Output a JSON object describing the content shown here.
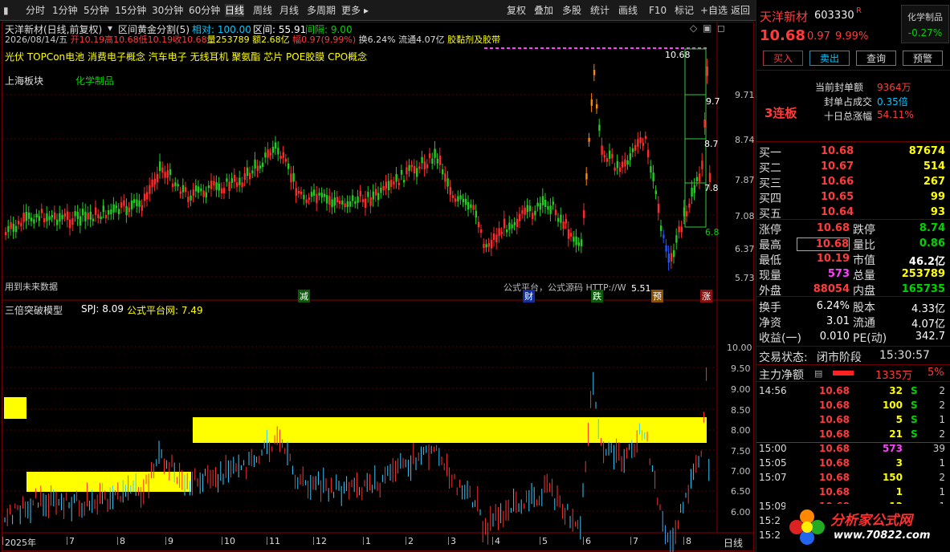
{
  "toolbar": {
    "items": [
      "分时",
      "1分钟",
      "5分钟",
      "15分钟",
      "30分钟",
      "60分钟",
      "日线",
      "周线",
      "月线",
      "多周期",
      "更多"
    ],
    "right": [
      "复权",
      "叠加",
      "多股",
      "统计",
      "画线",
      "F10",
      "标记",
      "+自选",
      "返回"
    ]
  },
  "chart_header": {
    "title": "天洋新材(日线,前复权)",
    "indicator": "区间黄金分割(5)",
    "relative": "相对: 100.00",
    "interval": "区间: 55.91",
    "gap": "间隔: 9.00"
  },
  "ohlc": {
    "date": "2026/08/14/五",
    "open": "开10.19",
    "high": "高10.68",
    "low": "低10.19",
    "close": "收10.68",
    "volume": "量253789",
    "amount": "额2.68亿",
    "change": "幅0.97(9.99%)",
    "turnover": "换6.24%",
    "float": "流通4.07亿",
    "concept": "胶黏剂及胶带"
  },
  "concepts": "光伏 TOPCon电池 消费电子概念 汽车电子 无线耳机 聚氨酯 芯片 POE胶膜 CPO概念",
  "sector": {
    "board": "上海板块",
    "industry": "化学制品"
  },
  "future_note": "用到未来数据",
  "watermark_note": "公式平台，公式源码 HTTP://W",
  "price_axis": [
    "9.71",
    "8.74",
    "7.87",
    "7.08",
    "6.37",
    "5.73"
  ],
  "price_top": "10.68",
  "fib_labels": [
    "9.7",
    "8.7",
    "7.8",
    "6.8"
  ],
  "low_marker": "5.51",
  "events": [
    "减",
    "财",
    "跌",
    "预",
    "涨"
  ],
  "sub_header": {
    "name": "三倍突破模型",
    "spj": "SPJ: 8.09",
    "gsp": "公式平台网: 7.49"
  },
  "sub_axis": [
    "10.00",
    "9.50",
    "9.00",
    "8.50",
    "8.00",
    "7.50",
    "7.00",
    "6.50",
    "6.00"
  ],
  "months": [
    "2025年",
    "7",
    "8",
    "9",
    "10",
    "11",
    "12",
    "1",
    "2",
    "3",
    "4",
    "5",
    "6",
    "7",
    "8"
  ],
  "period_label": "日线",
  "stock": {
    "name": "天洋新材",
    "code": "603330",
    "r": "R",
    "industry": "化学制品",
    "ind_change": "-0.27%",
    "price": "10.68",
    "change": "0.97",
    "pct": "9.99%"
  },
  "trade_buttons": [
    "买入",
    "卖出",
    "查询",
    "预警"
  ],
  "limit_info": {
    "rows": [
      {
        "k": "当前封单额",
        "v": "9364万"
      },
      {
        "k": "封单占成交",
        "v": "0.35倍"
      },
      {
        "k": "十日总涨幅",
        "v": "54.11%"
      }
    ],
    "streak": "3连板"
  },
  "bids": [
    {
      "k": "买一",
      "p": "10.68",
      "v": "87674"
    },
    {
      "k": "买二",
      "p": "10.67",
      "v": "514"
    },
    {
      "k": "买三",
      "p": "10.66",
      "v": "267"
    },
    {
      "k": "买四",
      "p": "10.65",
      "v": "99"
    },
    {
      "k": "买五",
      "p": "10.64",
      "v": "93"
    }
  ],
  "stats": [
    {
      "k1": "涨停",
      "v1": "10.68",
      "k2": "跌停",
      "v2": "8.74"
    },
    {
      "k1": "最高",
      "v1": "10.68",
      "k2": "量比",
      "v2": "0.86"
    },
    {
      "k1": "最低",
      "v1": "10.19",
      "k2": "市值",
      "v2": "46.2亿"
    },
    {
      "k1": "现量",
      "v1": "573",
      "k2": "总量",
      "v2": "253789"
    },
    {
      "k1": "外盘",
      "v1": "88054",
      "k2": "内盘",
      "v2": "165735"
    }
  ],
  "stats2": [
    {
      "k1": "换手",
      "v1": "6.24%",
      "k2": "股本",
      "v2": "4.33亿"
    },
    {
      "k1": "净资",
      "v1": "3.01",
      "k2": "流通",
      "v2": "4.07亿"
    },
    {
      "k1": "收益(一)",
      "v1": "0.010",
      "k2": "PE(动)",
      "v2": "342.7"
    }
  ],
  "status": {
    "label": "交易状态:",
    "value": "闭市阶段",
    "time": "15:30:57"
  },
  "main_flow": {
    "label": "主力净额",
    "value": "1335万",
    "pct": "5%"
  },
  "ticks": [
    {
      "t": "14:56",
      "p": "10.68",
      "v": "32",
      "s": "S",
      "n": "2"
    },
    {
      "t": "",
      "p": "10.68",
      "v": "100",
      "s": "S",
      "n": "2"
    },
    {
      "t": "",
      "p": "10.68",
      "v": "5",
      "s": "S",
      "n": "1"
    },
    {
      "t": "",
      "p": "10.68",
      "v": "21",
      "s": "S",
      "n": "2"
    },
    {
      "t": "15:00",
      "p": "10.68",
      "v": "573",
      "s": "",
      "n": "39"
    },
    {
      "t": "15:05",
      "p": "10.68",
      "v": "3",
      "s": "",
      "n": "1"
    },
    {
      "t": "15:07",
      "p": "10.68",
      "v": "150",
      "s": "",
      "n": "2"
    },
    {
      "t": "",
      "p": "10.68",
      "v": "1",
      "s": "",
      "n": "1"
    },
    {
      "t": "15:09",
      "p": "10.68",
      "v": "13",
      "s": "",
      "n": "1"
    },
    {
      "t": "15:2",
      "p": "",
      "v": "",
      "s": "",
      "n": ""
    },
    {
      "t": "15:2",
      "p": "",
      "v": "",
      "s": "",
      "n": ""
    }
  ],
  "logo": {
    "name": "分析家公式网",
    "url": "www.70822.com"
  }
}
